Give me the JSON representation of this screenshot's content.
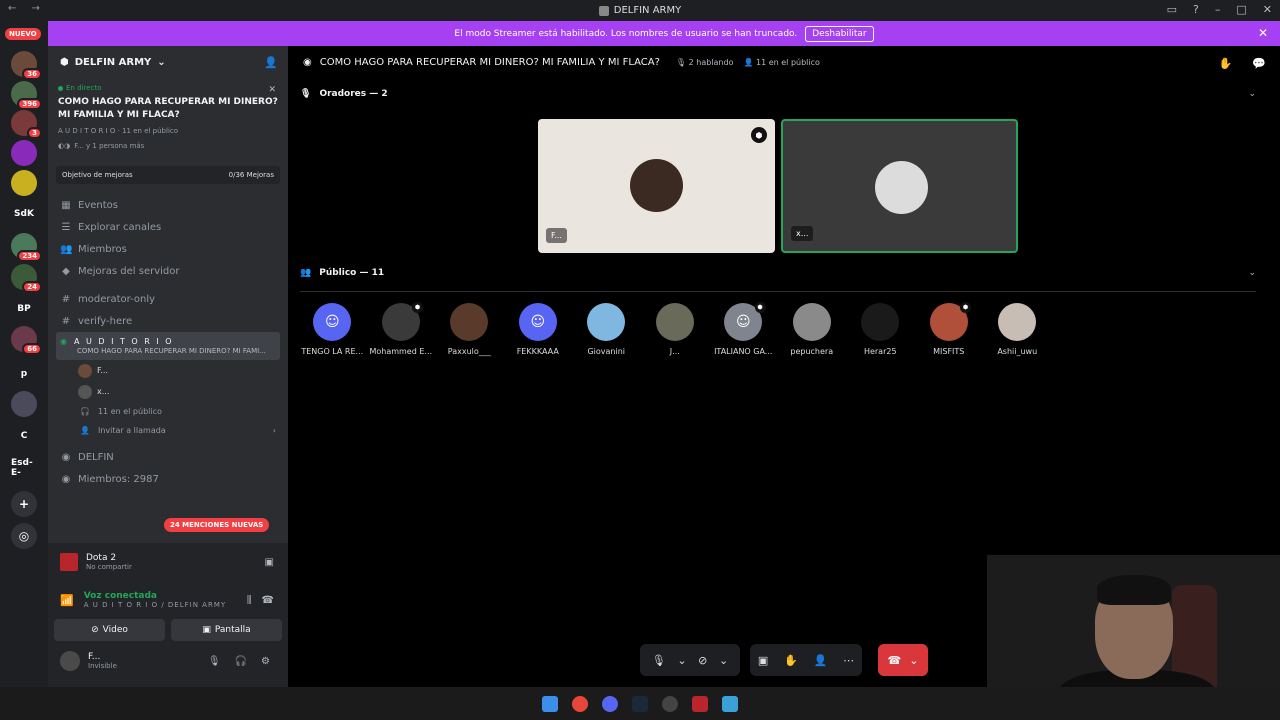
{
  "window": {
    "title": "DELFIN ARMY",
    "nav": "← →"
  },
  "banner": {
    "text": "El modo Streamer está habilitado. Los nombres de usuario se han truncado.",
    "button": "Deshabilitar"
  },
  "servers": {
    "new_badge": "NUEVO",
    "items": [
      {
        "label": "",
        "badge": "36"
      },
      {
        "label": "",
        "badge": "396"
      },
      {
        "label": "",
        "badge": "3"
      },
      {
        "label": "",
        "badge": ""
      },
      {
        "label": "",
        "badge": ""
      },
      {
        "label": "SdK",
        "badge": ""
      },
      {
        "label": "",
        "badge": "234"
      },
      {
        "label": "",
        "badge": "24"
      },
      {
        "label": "BP",
        "badge": ""
      },
      {
        "label": "",
        "badge": "66"
      },
      {
        "label": "p",
        "badge": ""
      },
      {
        "label": "",
        "badge": ""
      },
      {
        "label": "C",
        "badge": ""
      },
      {
        "label": "Esd-E-",
        "badge": ""
      }
    ]
  },
  "sidebar": {
    "server_name": "DELFIN ARMY",
    "live_tag": "En directo",
    "live_title": "COMO HAGO PARA RECUPERAR MI DINERO? MI FAMILIA Y MI FLACA?",
    "live_channel": "A U D I T O R I O",
    "live_public": "11 en el público",
    "live_participants": "F... y 1 persona más",
    "goal_label": "Objetivo de mejoras",
    "goal_value": "0/36 Mejoras",
    "nav": [
      "Eventos",
      "Explorar canales",
      "Miembros",
      "Mejoras del servidor"
    ],
    "channels": [
      "moderator-only",
      "verify-here"
    ],
    "active_channel": "A U D I T O R I O",
    "active_topic": "COMO HAGO PARA RECUPERAR MI DINERO? MI FAMI...",
    "stage_users": [
      "F...",
      "x..."
    ],
    "stage_public": "11 en el público",
    "invite": "Invitar a llamada",
    "more_channels": [
      "DELFIN",
      "Miembros: 2987"
    ],
    "mentions": "24 MENCIONES NUEVAS"
  },
  "panel": {
    "game": "Dota 2",
    "game_sub": "No compartir",
    "voice": "Voz conectada",
    "voice_sub": "A U D I T O R I O / DELFIN ARMY",
    "video_btn": "Video",
    "screen_btn": "Pantalla",
    "user_name": "F...",
    "user_status": "Invisible"
  },
  "stage": {
    "title": "COMO HAGO PARA RECUPERAR MI DINERO? MI FAMILIA Y MI FLACA?",
    "speaking": "2 hablando",
    "public": "11 en el público",
    "speakers_header": "Oradores — 2",
    "speakers": [
      "F...",
      "x..."
    ],
    "audience_header": "Público — 11",
    "audience": [
      {
        "name": "TENGO LA RE...",
        "color": "#5865f2",
        "discord": true,
        "mod": false
      },
      {
        "name": "Mohammed E...",
        "color": "#3a3a3a",
        "discord": false,
        "mod": true
      },
      {
        "name": "Paxxulo___",
        "color": "#5a3a2a",
        "discord": false,
        "mod": false
      },
      {
        "name": "FEKKKAAA",
        "color": "#5865f2",
        "discord": true,
        "mod": false
      },
      {
        "name": "Giovanini",
        "color": "#7fb7e0",
        "discord": false,
        "mod": false
      },
      {
        "name": "J...",
        "color": "#6a6a5a",
        "discord": false,
        "mod": false
      },
      {
        "name": "ITALIANO GA...",
        "color": "#80848e",
        "discord": true,
        "mod": true
      },
      {
        "name": "pepuchera",
        "color": "#8a8a8a",
        "discord": false,
        "mod": false
      },
      {
        "name": "Herar25",
        "color": "#1a1a1a",
        "discord": false,
        "mod": false
      },
      {
        "name": "MISFITS",
        "color": "#b0503a",
        "discord": false,
        "mod": true
      },
      {
        "name": "Ashii_uwu",
        "color": "#c8bdb5",
        "discord": false,
        "mod": false
      }
    ]
  },
  "colors": {
    "accent": "#5865f2",
    "streamer": "#a541f2",
    "live": "#23a55a",
    "danger": "#da373c"
  }
}
